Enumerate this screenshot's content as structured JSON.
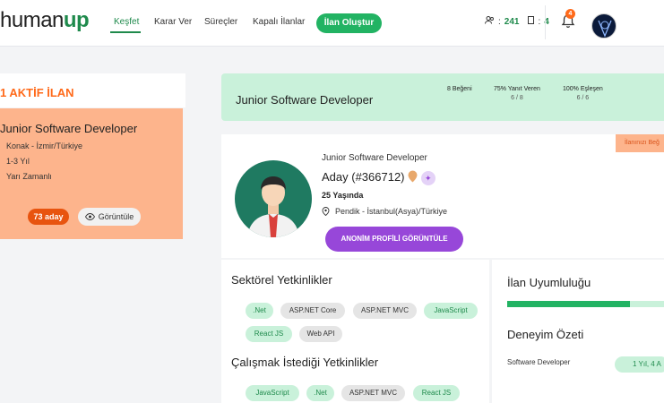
{
  "brand": {
    "part1": "human",
    "part2": "up"
  },
  "nav": {
    "items": [
      {
        "label": "Keşfet",
        "active": true
      },
      {
        "label": "Karar Ver",
        "active": false
      },
      {
        "label": "Süreçler",
        "active": false
      },
      {
        "label": "Kapalı İlanlar",
        "active": false
      }
    ],
    "create_label": "İlan Oluştur"
  },
  "stats": {
    "users": "241",
    "docs": "4"
  },
  "notifications": {
    "count": "4"
  },
  "left_panel": {
    "header": "1 AKTİF İLAN",
    "job": {
      "title": "Junior Software Developer",
      "location": "Konak - İzmir/Türkiye",
      "experience": "1-3 Yıl",
      "type": "Yarı Zamanlı",
      "candidates": "73 aday",
      "view_label": "Görüntüle"
    }
  },
  "banner": {
    "title": "Junior Software Developer",
    "stats": [
      {
        "label": "8 Beğeni",
        "sub": ""
      },
      {
        "label": "75% Yanıt Veren",
        "sub": "6 / 8"
      },
      {
        "label": "100% Eşleşen",
        "sub": "6 / 6"
      }
    ]
  },
  "candidate": {
    "role": "Junior Software Developer",
    "name": "Aday (#366712)",
    "age": "25 Yaşında",
    "location": "Pendik - İstanbul(Asya)/Türkiye",
    "anon_button": "ANONİM PROFİLİ GÖRÜNTÜLE",
    "corner_tag": "İlanınızı Beğ"
  },
  "skills": {
    "sector_title": "Sektörel Yetkinlikler",
    "sector": [
      {
        "label": ".Net",
        "style": "green"
      },
      {
        "label": "ASP.NET Core",
        "style": "gray"
      },
      {
        "label": "ASP.NET MVC",
        "style": "gray"
      },
      {
        "label": "JavaScript",
        "style": "green"
      },
      {
        "label": "React JS",
        "style": "green"
      },
      {
        "label": "Web API",
        "style": "gray"
      }
    ],
    "wish_title": "Çalışmak İstediği Yetkinlikler",
    "wish": [
      {
        "label": "JavaScript",
        "style": "green"
      },
      {
        "label": ".Net",
        "style": "green"
      },
      {
        "label": "ASP.NET MVC",
        "style": "gray"
      },
      {
        "label": "React JS",
        "style": "green"
      }
    ]
  },
  "right_panel": {
    "fit_title": "İlan Uyumluluğu",
    "fit_value": 0.78,
    "exp_title": "Deneyim Özeti",
    "exp_role": "Software Developer",
    "exp_duration": "1 Yıl, 4 A"
  },
  "colors": {
    "brand_green": "#1f8a4c",
    "accent_orange": "#ff6a1a",
    "purple": "#9747d9",
    "mint": "#c9f1da"
  }
}
